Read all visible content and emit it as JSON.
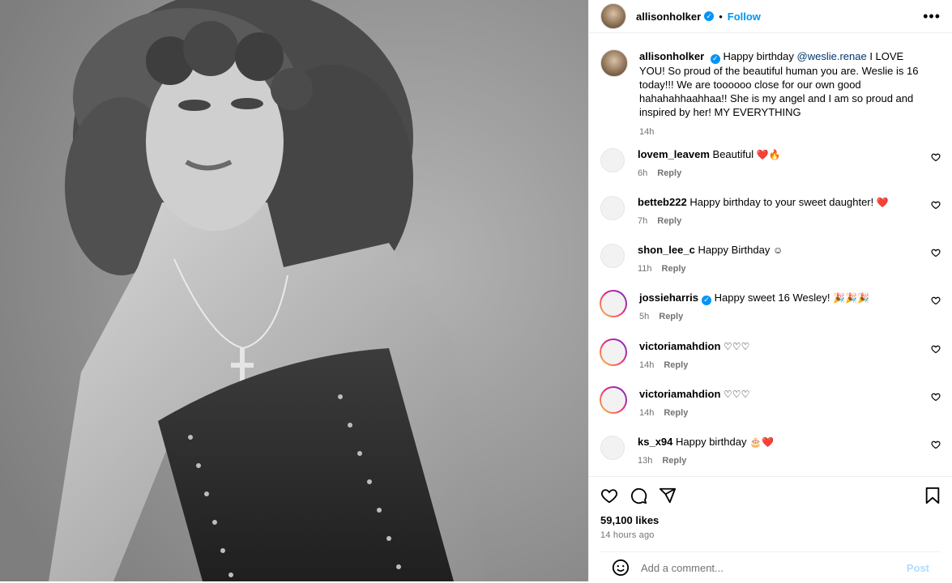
{
  "post": {
    "username": "allisonholker",
    "follow_label": "Follow",
    "separator": "•",
    "more_label": "•••",
    "caption_text_before": "Happy birthday ",
    "caption_mention": "@weslie.renae",
    "caption_text_after": " I LOVE YOU! So proud of the beautiful human you are. Weslie is 16 today!!! We are toooooo close for our own good hahahahhaahhaa!! She is my angel and I am so proud and inspired by her! MY EVERYTHING",
    "caption_time": "14h"
  },
  "comments": [
    {
      "username": "lovem_leavem",
      "text": "Beautiful",
      "emoji": "❤️🔥",
      "time": "6h",
      "reply": "Reply",
      "story_ring": false,
      "verified": false
    },
    {
      "username": "betteb222",
      "text": "Happy birthday to your sweet daughter!",
      "emoji": "❤️",
      "time": "7h",
      "reply": "Reply",
      "story_ring": false,
      "verified": false
    },
    {
      "username": "shon_lee_c",
      "text": "Happy Birthday",
      "emoji": "☺",
      "time": "11h",
      "reply": "Reply",
      "story_ring": false,
      "verified": false
    },
    {
      "username": "jossieharris",
      "text": "Happy sweet 16 Wesley!",
      "emoji": "🎉🎉🎉",
      "time": "5h",
      "reply": "Reply",
      "story_ring": true,
      "verified": true
    },
    {
      "username": "victoriamahdion",
      "text": "",
      "emoji": "♡♡♡",
      "time": "14h",
      "reply": "Reply",
      "story_ring": true,
      "verified": false
    },
    {
      "username": "victoriamahdion",
      "text": "",
      "emoji": "♡♡♡",
      "time": "14h",
      "reply": "Reply",
      "story_ring": true,
      "verified": false
    },
    {
      "username": "ks_x94",
      "text": "Happy birthday",
      "emoji": "🎂❤️",
      "time": "13h",
      "reply": "Reply",
      "story_ring": false,
      "verified": false
    }
  ],
  "footer": {
    "likes": "59,100 likes",
    "time_ago": "14 hours ago",
    "add_comment_placeholder": "Add a comment...",
    "post_label": "Post"
  },
  "icons": {
    "like": "heart-icon",
    "comment": "comment-icon",
    "share": "share-icon",
    "save": "bookmark-icon",
    "emoji": "emoji-icon"
  },
  "colors": {
    "accent": "#0095f6",
    "muted": "#737373",
    "post_disabled": "#b3dbff"
  }
}
